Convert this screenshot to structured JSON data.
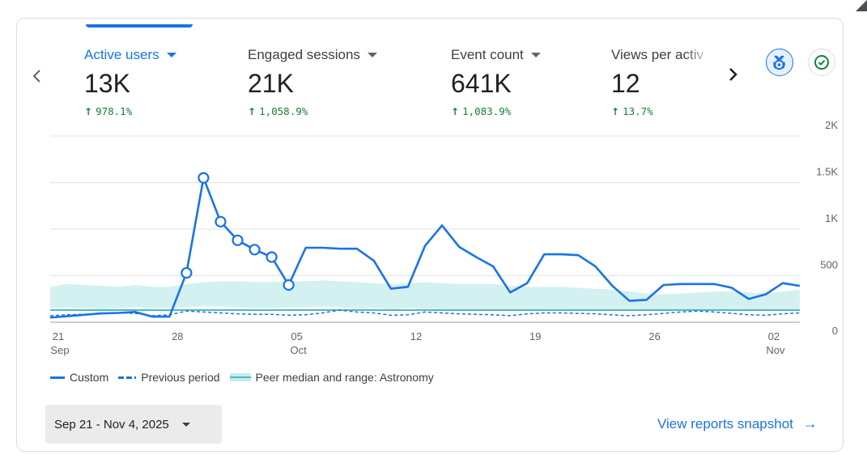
{
  "metrics": [
    {
      "label": "Active users",
      "value": "13K",
      "change": "978.1%",
      "active": true
    },
    {
      "label": "Engaged sessions",
      "value": "21K",
      "change": "1,058.9%",
      "active": false
    },
    {
      "label": "Event count",
      "value": "641K",
      "change": "1,083.9%",
      "active": false
    },
    {
      "label": "Views per activ",
      "value": "12",
      "change": "13.7%",
      "active": false
    }
  ],
  "icons": {
    "prev": "chevron-left-icon",
    "next": "chevron-right-icon",
    "benchmark": "benchmark-icon",
    "check": "check-circle-icon",
    "trend_up": "arrow-up-icon"
  },
  "colors": {
    "accent": "#1a73e8",
    "positive": "#188038",
    "peer_band": "#c6ecee",
    "peer_line": "#4fb8bf"
  },
  "chart_data": {
    "type": "line",
    "x_axis_labels": [
      {
        "day": 0,
        "label": "21",
        "sub": "Sep"
      },
      {
        "day": 7,
        "label": "28",
        "sub": ""
      },
      {
        "day": 14,
        "label": "05",
        "sub": "Oct"
      },
      {
        "day": 21,
        "label": "12",
        "sub": ""
      },
      {
        "day": 28,
        "label": "19",
        "sub": ""
      },
      {
        "day": 35,
        "label": "26",
        "sub": ""
      },
      {
        "day": 42,
        "label": "02",
        "sub": "Nov"
      }
    ],
    "y_ticks": [
      "0",
      "500",
      "1K",
      "1.5K",
      "2K"
    ],
    "y_tick_values": [
      0,
      500,
      1000,
      1500,
      2000
    ],
    "ylim": [
      0,
      2000
    ],
    "x_range": [
      "2025-09-21",
      "2025-11-04"
    ],
    "grid": true,
    "series": [
      {
        "name": "Custom",
        "style": "solid",
        "values": [
          50,
          65,
          80,
          95,
          100,
          110,
          60,
          60,
          530,
          1550,
          1080,
          880,
          780,
          700,
          400,
          800,
          800,
          790,
          790,
          660,
          360,
          380,
          820,
          1040,
          810,
          700,
          600,
          320,
          420,
          730,
          730,
          720,
          600,
          390,
          230,
          240,
          400,
          410,
          410,
          410,
          370,
          250,
          300,
          420,
          390
        ],
        "hollow_point_days": [
          8,
          9,
          10,
          11,
          12,
          13,
          14
        ]
      },
      {
        "name": "Previous period",
        "style": "dashed",
        "values": [
          70,
          80,
          85,
          95,
          100,
          95,
          70,
          80,
          120,
          110,
          100,
          90,
          85,
          85,
          75,
          80,
          100,
          130,
          110,
          100,
          75,
          80,
          110,
          100,
          90,
          85,
          80,
          70,
          90,
          100,
          100,
          95,
          90,
          80,
          70,
          80,
          95,
          110,
          120,
          110,
          95,
          80,
          75,
          90,
          100
        ]
      }
    ],
    "peer_range": {
      "name": "Peer median and range: Astronomy",
      "median": 130,
      "upper": [
        380,
        410,
        400,
        390,
        380,
        400,
        380,
        380,
        410,
        430,
        440,
        440,
        430,
        430,
        440,
        440,
        450,
        440,
        430,
        420,
        410,
        420,
        430,
        420,
        410,
        410,
        410,
        390,
        380,
        380,
        380,
        370,
        360,
        350,
        330,
        310,
        300,
        310,
        320,
        330,
        330,
        320,
        310,
        330,
        350
      ],
      "lower": [
        150,
        160,
        150,
        140,
        150,
        160,
        150,
        150,
        160,
        170,
        170,
        160,
        150,
        150,
        160,
        160,
        170,
        160,
        150,
        150,
        140,
        150,
        150,
        140,
        140,
        140,
        140,
        130,
        130,
        140,
        140,
        140,
        130,
        130,
        130,
        120,
        120,
        130,
        130,
        130,
        130,
        120,
        120,
        130,
        130
      ]
    }
  },
  "date_range": {
    "label": "Sep 21 - Nov 4, 2025"
  },
  "snapshot_link": {
    "label": "View reports snapshot"
  }
}
